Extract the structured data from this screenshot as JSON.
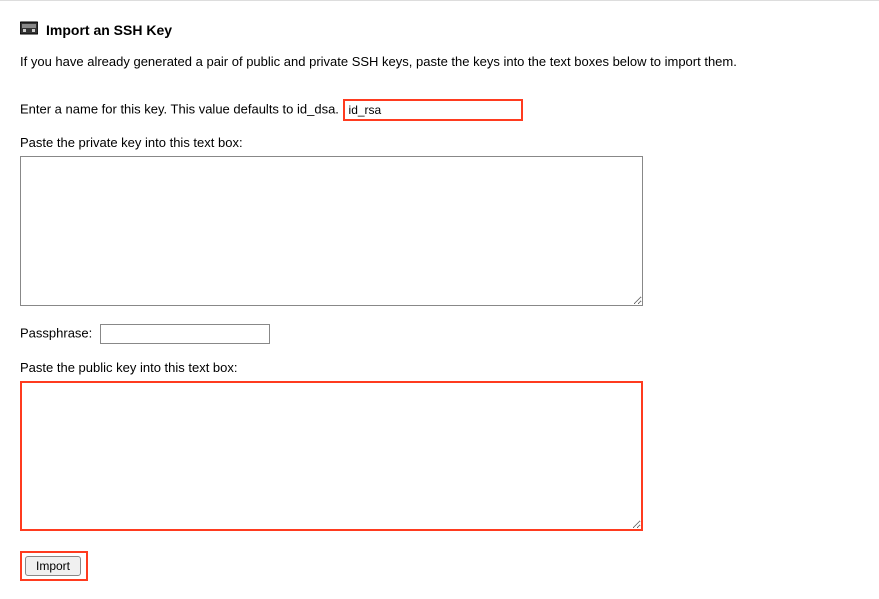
{
  "heading": "Import an SSH Key",
  "intro_text": "If you have already generated a pair of public and private SSH keys, paste the keys into the text boxes below to import them.",
  "icon_name": "cassette-key-icon",
  "name_field": {
    "label": "Enter a name for this key. This value defaults to id_dsa.",
    "value": "id_rsa"
  },
  "private_key_field": {
    "label": "Paste the private key into this text box:",
    "value": ""
  },
  "passphrase_field": {
    "label": "Passphrase:",
    "value": ""
  },
  "public_key_field": {
    "label": "Paste the public key into this text box:",
    "value": ""
  },
  "import_button": {
    "label": "Import"
  },
  "highlight_color": "#ff3b1f"
}
